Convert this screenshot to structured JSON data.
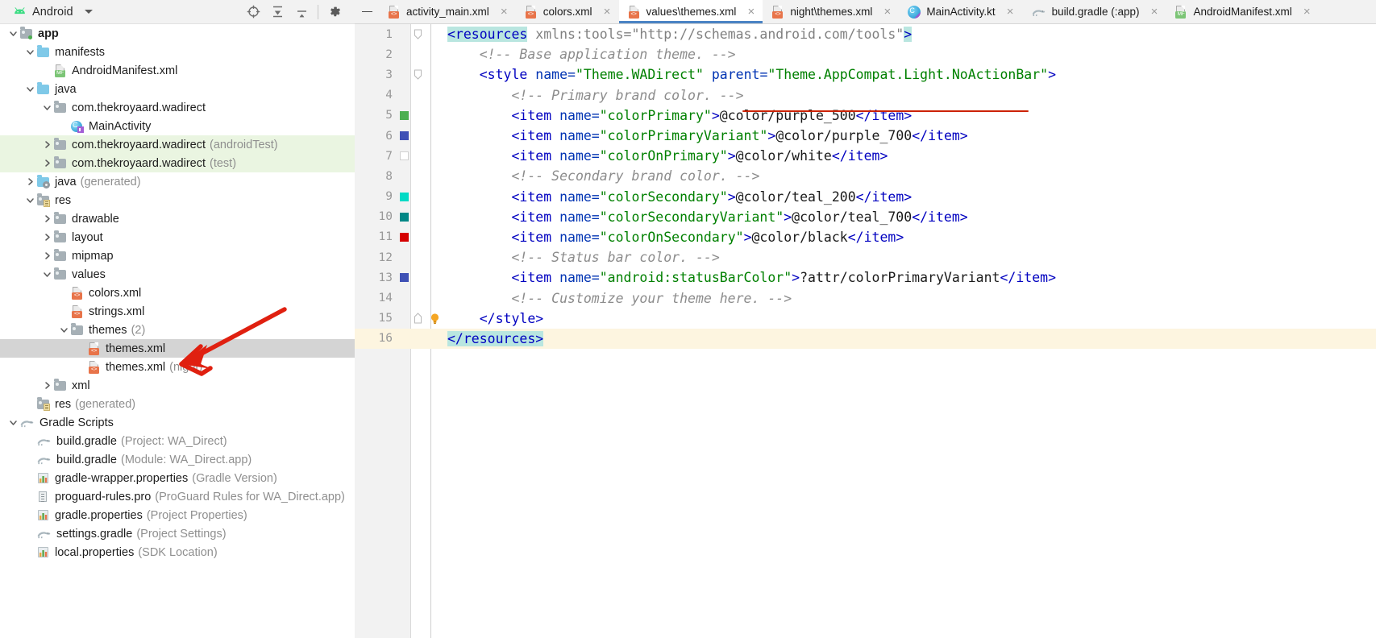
{
  "project_toolbar": {
    "title": "Android",
    "icons": [
      "target-locate-icon",
      "collapse-all-icon",
      "expand-all-icon",
      "settings-gear-icon"
    ],
    "dropdown": "chevron-down-icon"
  },
  "editor_tabs": {
    "minimize_label": "minimize-icon",
    "items": [
      {
        "label": "activity_main.xml",
        "icon": "xml-file-icon",
        "badge": "<>",
        "active": false
      },
      {
        "label": "colors.xml",
        "icon": "xml-file-icon",
        "badge": "<>",
        "active": false
      },
      {
        "label": "values\\themes.xml",
        "icon": "xml-file-icon",
        "badge": "<>",
        "active": true
      },
      {
        "label": "night\\themes.xml",
        "icon": "xml-file-icon",
        "badge": "<>",
        "active": false
      },
      {
        "label": "MainActivity.kt",
        "icon": "kotlin-file-icon",
        "badge": "",
        "active": false
      },
      {
        "label": "build.gradle (:app)",
        "icon": "gradle-file-icon",
        "badge": "",
        "active": false
      },
      {
        "label": "AndroidManifest.xml",
        "icon": "manifest-file-icon",
        "badge": "MF",
        "active": false
      }
    ],
    "close_glyph": "×"
  },
  "tree": {
    "rows": [
      {
        "indent": 0,
        "twist": "down",
        "icon": "folder-module-app",
        "label": "app",
        "dim": "",
        "bold": true,
        "style": ""
      },
      {
        "indent": 1,
        "twist": "down",
        "icon": "folder-blue",
        "label": "manifests",
        "dim": "",
        "bold": false,
        "style": ""
      },
      {
        "indent": 2,
        "twist": "none",
        "icon": "manifest-file",
        "label": "AndroidManifest.xml",
        "dim": "",
        "bold": false,
        "style": ""
      },
      {
        "indent": 1,
        "twist": "down",
        "icon": "folder-blue",
        "label": "java",
        "dim": "",
        "bold": false,
        "style": ""
      },
      {
        "indent": 2,
        "twist": "down",
        "icon": "folder-gray",
        "label": "com.thekroyaard.wadirect",
        "dim": "",
        "bold": false,
        "style": ""
      },
      {
        "indent": 3,
        "twist": "none",
        "icon": "kotlin-class",
        "label": "MainActivity",
        "dim": "",
        "bold": false,
        "style": ""
      },
      {
        "indent": 2,
        "twist": "right",
        "icon": "folder-gray",
        "label": "com.thekroyaard.wadirect",
        "dim": "(androidTest)",
        "bold": false,
        "style": "testbg"
      },
      {
        "indent": 2,
        "twist": "right",
        "icon": "folder-gray",
        "label": "com.thekroyaard.wadirect",
        "dim": "(test)",
        "bold": false,
        "style": "testbg"
      },
      {
        "indent": 1,
        "twist": "right",
        "icon": "folder-generated",
        "label": "java",
        "dim": "(generated)",
        "bold": false,
        "style": ""
      },
      {
        "indent": 1,
        "twist": "down",
        "icon": "folder-res",
        "label": "res",
        "dim": "",
        "bold": false,
        "style": ""
      },
      {
        "indent": 2,
        "twist": "right",
        "icon": "folder-gray",
        "label": "drawable",
        "dim": "",
        "bold": false,
        "style": ""
      },
      {
        "indent": 2,
        "twist": "right",
        "icon": "folder-gray",
        "label": "layout",
        "dim": "",
        "bold": false,
        "style": ""
      },
      {
        "indent": 2,
        "twist": "right",
        "icon": "folder-gray",
        "label": "mipmap",
        "dim": "",
        "bold": false,
        "style": ""
      },
      {
        "indent": 2,
        "twist": "down",
        "icon": "folder-gray",
        "label": "values",
        "dim": "",
        "bold": false,
        "style": ""
      },
      {
        "indent": 3,
        "twist": "none",
        "icon": "xml-file",
        "label": "colors.xml",
        "dim": "",
        "bold": false,
        "style": ""
      },
      {
        "indent": 3,
        "twist": "none",
        "icon": "xml-file",
        "label": "strings.xml",
        "dim": "",
        "bold": false,
        "style": ""
      },
      {
        "indent": 3,
        "twist": "down",
        "icon": "folder-gray",
        "label": "themes",
        "dim": "(2)",
        "bold": false,
        "style": ""
      },
      {
        "indent": 4,
        "twist": "none",
        "icon": "xml-file",
        "label": "themes.xml",
        "dim": "",
        "bold": false,
        "style": "sel"
      },
      {
        "indent": 4,
        "twist": "none",
        "icon": "xml-file",
        "label": "themes.xml",
        "dim": "(night)",
        "bold": false,
        "style": ""
      },
      {
        "indent": 2,
        "twist": "right",
        "icon": "folder-gray",
        "label": "xml",
        "dim": "",
        "bold": false,
        "style": ""
      },
      {
        "indent": 1,
        "twist": "none",
        "icon": "folder-res",
        "label": "res",
        "dim": "(generated)",
        "bold": false,
        "style": ""
      },
      {
        "indent": 0,
        "twist": "down",
        "icon": "gradle-elephant",
        "label": "Gradle Scripts",
        "dim": "",
        "bold": false,
        "style": ""
      },
      {
        "indent": 1,
        "twist": "none",
        "icon": "gradle-elephant",
        "label": "build.gradle",
        "dim": "(Project: WA_Direct)",
        "bold": false,
        "style": ""
      },
      {
        "indent": 1,
        "twist": "none",
        "icon": "gradle-elephant",
        "label": "build.gradle",
        "dim": "(Module: WA_Direct.app)",
        "bold": false,
        "style": ""
      },
      {
        "indent": 1,
        "twist": "none",
        "icon": "properties-file",
        "label": "gradle-wrapper.properties",
        "dim": "(Gradle Version)",
        "bold": false,
        "style": ""
      },
      {
        "indent": 1,
        "twist": "none",
        "icon": "proguard-file",
        "label": "proguard-rules.pro",
        "dim": "(ProGuard Rules for WA_Direct.app)",
        "bold": false,
        "style": ""
      },
      {
        "indent": 1,
        "twist": "none",
        "icon": "properties-file",
        "label": "gradle.properties",
        "dim": "(Project Properties)",
        "bold": false,
        "style": ""
      },
      {
        "indent": 1,
        "twist": "none",
        "icon": "gradle-elephant",
        "label": "settings.gradle",
        "dim": "(Project Settings)",
        "bold": false,
        "style": ""
      },
      {
        "indent": 1,
        "twist": "none",
        "icon": "properties-file",
        "label": "local.properties",
        "dim": "(SDK Location)",
        "bold": false,
        "style": ""
      }
    ],
    "annotation": {
      "type": "red-arrow",
      "points_to": "themes.xml"
    }
  },
  "code": {
    "file": "values\\themes.xml",
    "lines": [
      {
        "n": 1,
        "swatch": "",
        "fold": "down",
        "bulb": false,
        "hl": false,
        "tokens": [
          {
            "t": "<resources",
            "c": "t-tag",
            "hl": true
          },
          {
            "t": " xmlns:tools=",
            "c": "t-plain",
            "hl": false
          },
          {
            "t": "\"http://schemas.android.com/tools\"",
            "c": "t-plain",
            "hl": false
          },
          {
            "t": ">",
            "c": "t-tag",
            "hl": true
          }
        ]
      },
      {
        "n": 2,
        "swatch": "",
        "fold": "",
        "bulb": false,
        "hl": false,
        "tokens": [
          {
            "t": "    <!-- Base application theme. -->",
            "c": "t-com",
            "hl": false
          }
        ]
      },
      {
        "n": 3,
        "swatch": "",
        "fold": "down",
        "bulb": false,
        "hl": false,
        "tokens": [
          {
            "t": "    <style",
            "c": "t-tag",
            "hl": false
          },
          {
            "t": " name=",
            "c": "t-attr",
            "hl": false
          },
          {
            "t": "\"Theme.WADirect\"",
            "c": "t-val",
            "hl": false
          },
          {
            "t": " parent=",
            "c": "t-attr",
            "hl": false
          },
          {
            "t": "\"Theme.AppCompat.Light.NoActionBar\"",
            "c": "t-val",
            "hl": false
          },
          {
            "t": ">",
            "c": "t-tag",
            "hl": false
          }
        ]
      },
      {
        "n": 4,
        "swatch": "",
        "fold": "",
        "bulb": false,
        "hl": false,
        "tokens": [
          {
            "t": "        <!-- Primary brand color. -->",
            "c": "t-com",
            "hl": false
          }
        ]
      },
      {
        "n": 5,
        "swatch": "#4caf50",
        "fold": "",
        "bulb": false,
        "hl": false,
        "tokens": [
          {
            "t": "        <item",
            "c": "t-tag",
            "hl": false
          },
          {
            "t": " name=",
            "c": "t-attr",
            "hl": false
          },
          {
            "t": "\"colorPrimary\"",
            "c": "t-val",
            "hl": false
          },
          {
            "t": ">",
            "c": "t-tag",
            "hl": false
          },
          {
            "t": "@color/purple_500",
            "c": "t-txt",
            "hl": false
          },
          {
            "t": "</item>",
            "c": "t-tag",
            "hl": false
          }
        ]
      },
      {
        "n": 6,
        "swatch": "#3f51b5",
        "fold": "",
        "bulb": false,
        "hl": false,
        "tokens": [
          {
            "t": "        <item",
            "c": "t-tag",
            "hl": false
          },
          {
            "t": " name=",
            "c": "t-attr",
            "hl": false
          },
          {
            "t": "\"colorPrimaryVariant\"",
            "c": "t-val",
            "hl": false
          },
          {
            "t": ">",
            "c": "t-tag",
            "hl": false
          },
          {
            "t": "@color/purple_700",
            "c": "t-txt",
            "hl": false
          },
          {
            "t": "</item>",
            "c": "t-tag",
            "hl": false
          }
        ]
      },
      {
        "n": 7,
        "swatch": "#ffffff",
        "fold": "",
        "bulb": false,
        "hl": false,
        "tokens": [
          {
            "t": "        <item",
            "c": "t-tag",
            "hl": false
          },
          {
            "t": " name=",
            "c": "t-attr",
            "hl": false
          },
          {
            "t": "\"colorOnPrimary\"",
            "c": "t-val",
            "hl": false
          },
          {
            "t": ">",
            "c": "t-tag",
            "hl": false
          },
          {
            "t": "@color/white",
            "c": "t-txt",
            "hl": false
          },
          {
            "t": "</item>",
            "c": "t-tag",
            "hl": false
          }
        ]
      },
      {
        "n": 8,
        "swatch": "",
        "fold": "",
        "bulb": false,
        "hl": false,
        "tokens": [
          {
            "t": "        <!-- Secondary brand color. -->",
            "c": "t-com",
            "hl": false
          }
        ]
      },
      {
        "n": 9,
        "swatch": "#03dac5",
        "fold": "",
        "bulb": false,
        "hl": false,
        "tokens": [
          {
            "t": "        <item",
            "c": "t-tag",
            "hl": false
          },
          {
            "t": " name=",
            "c": "t-attr",
            "hl": false
          },
          {
            "t": "\"colorSecondary\"",
            "c": "t-val",
            "hl": false
          },
          {
            "t": ">",
            "c": "t-tag",
            "hl": false
          },
          {
            "t": "@color/teal_200",
            "c": "t-txt",
            "hl": false
          },
          {
            "t": "</item>",
            "c": "t-tag",
            "hl": false
          }
        ]
      },
      {
        "n": 10,
        "swatch": "#018786",
        "fold": "",
        "bulb": false,
        "hl": false,
        "tokens": [
          {
            "t": "        <item",
            "c": "t-tag",
            "hl": false
          },
          {
            "t": " name=",
            "c": "t-attr",
            "hl": false
          },
          {
            "t": "\"colorSecondaryVariant\"",
            "c": "t-val",
            "hl": false
          },
          {
            "t": ">",
            "c": "t-tag",
            "hl": false
          },
          {
            "t": "@color/teal_700",
            "c": "t-txt",
            "hl": false
          },
          {
            "t": "</item>",
            "c": "t-tag",
            "hl": false
          }
        ]
      },
      {
        "n": 11,
        "swatch": "#d50000",
        "fold": "",
        "bulb": false,
        "hl": false,
        "tokens": [
          {
            "t": "        <item",
            "c": "t-tag",
            "hl": false
          },
          {
            "t": " name=",
            "c": "t-attr",
            "hl": false
          },
          {
            "t": "\"colorOnSecondary\"",
            "c": "t-val",
            "hl": false
          },
          {
            "t": ">",
            "c": "t-tag",
            "hl": false
          },
          {
            "t": "@color/black",
            "c": "t-txt",
            "hl": false
          },
          {
            "t": "</item>",
            "c": "t-tag",
            "hl": false
          }
        ]
      },
      {
        "n": 12,
        "swatch": "",
        "fold": "",
        "bulb": false,
        "hl": false,
        "tokens": [
          {
            "t": "        <!-- Status bar color. -->",
            "c": "t-com",
            "hl": false
          }
        ]
      },
      {
        "n": 13,
        "swatch": "#3f51b5",
        "fold": "",
        "bulb": false,
        "hl": false,
        "tokens": [
          {
            "t": "        <item",
            "c": "t-tag",
            "hl": false
          },
          {
            "t": " name=",
            "c": "t-attr",
            "hl": false
          },
          {
            "t": "\"android:statusBarColor\"",
            "c": "t-val",
            "hl": false
          },
          {
            "t": ">",
            "c": "t-tag",
            "hl": false
          },
          {
            "t": "?attr/colorPrimaryVariant",
            "c": "t-txt",
            "hl": false
          },
          {
            "t": "</item>",
            "c": "t-tag",
            "hl": false
          }
        ]
      },
      {
        "n": 14,
        "swatch": "",
        "fold": "",
        "bulb": false,
        "hl": false,
        "tokens": [
          {
            "t": "        <!-- Customize your theme here. -->",
            "c": "t-com",
            "hl": false
          }
        ]
      },
      {
        "n": 15,
        "swatch": "",
        "fold": "up",
        "bulb": true,
        "hl": false,
        "tokens": [
          {
            "t": "    </style>",
            "c": "t-tag",
            "hl": false
          }
        ]
      },
      {
        "n": 16,
        "swatch": "",
        "fold": "",
        "bulb": false,
        "hl": true,
        "tokens": [
          {
            "t": "</resources>",
            "c": "t-tag",
            "hl": true
          }
        ]
      }
    ],
    "annotations": [
      {
        "type": "red-underline",
        "target": "\"Theme.AppCompat.Light.NoActionBar\"",
        "line": 3
      }
    ]
  },
  "colors": {
    "tab_active_underline": "#4a83c4",
    "selection_row": "#d4d4d4",
    "test_source_bg": "#eaf5e1",
    "caret_row": "#fdf5e0",
    "annotation_red": "#cc2200",
    "gutter_bg": "#f2f2f2",
    "xml_badge": "#e8744a",
    "manifest_badge": "#7cc576",
    "folder_blue": "#7fc9e8",
    "folder_gray": "#a6b0b6"
  }
}
